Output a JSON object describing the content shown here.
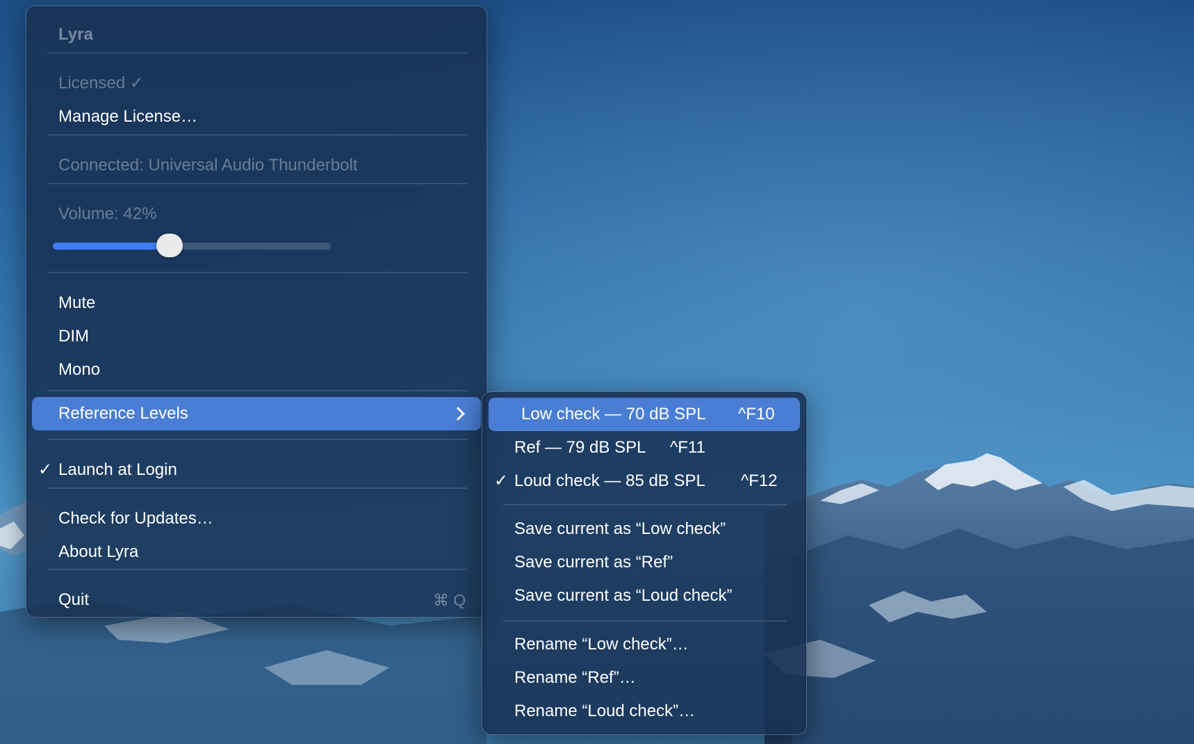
{
  "main_menu": {
    "app_header": "Lyra",
    "license_status": "Licensed ✓",
    "manage_license": "Manage License…",
    "connection_status": "Connected: Universal Audio Thunderbolt",
    "volume_label": "Volume: 42%",
    "volume_level_percent": 42,
    "mute": "Mute",
    "dim": "DIM",
    "mono": "Mono",
    "reference_levels": "Reference Levels",
    "launch_at_login": "Launch at Login",
    "launch_at_login_checked": true,
    "check_mark": "✓",
    "check_for_updates": "Check for Updates…",
    "about": "About Lyra",
    "quit": "Quit",
    "quit_shortcut": "⌘ Q"
  },
  "submenu": {
    "levels": [
      {
        "label": "Low check — 70 dB SPL",
        "shortcut": "^F10",
        "checked": false,
        "highlighted": true
      },
      {
        "label": "Ref — 79 dB SPL",
        "shortcut": "^F11",
        "checked": false,
        "highlighted": false
      },
      {
        "label": "Loud check — 85 dB SPL",
        "shortcut": "^F12",
        "checked": true,
        "highlighted": false
      }
    ],
    "check_mark": "✓",
    "save_low": "Save current as “Low check”",
    "save_ref": "Save current as “Ref”",
    "save_loud": "Save current as “Loud check”",
    "rename_low": "Rename “Low check”…",
    "rename_ref": "Rename “Ref”…",
    "rename_loud": "Rename “Loud check”…"
  },
  "colors": {
    "highlight": "#4a7ed4",
    "slider_fill": "#3d7ef2",
    "menu_background": "#173052"
  }
}
